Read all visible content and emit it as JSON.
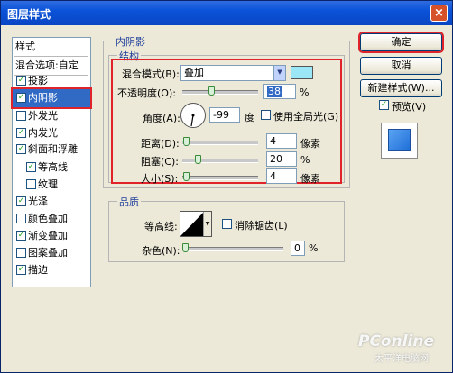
{
  "window": {
    "title": "图层样式",
    "close_glyph": "×"
  },
  "left_panel": {
    "header": "样式",
    "blend_options": "混合选项:自定",
    "items": [
      {
        "label": "投影",
        "checked": true
      },
      {
        "label": "内阴影",
        "checked": true
      },
      {
        "label": "外发光",
        "checked": false
      },
      {
        "label": "内发光",
        "checked": true
      },
      {
        "label": "斜面和浮雕",
        "checked": true
      },
      {
        "label": "等高线",
        "checked": true
      },
      {
        "label": "纹理",
        "checked": false
      },
      {
        "label": "光泽",
        "checked": true
      },
      {
        "label": "颜色叠加",
        "checked": false
      },
      {
        "label": "渐变叠加",
        "checked": true
      },
      {
        "label": "图案叠加",
        "checked": false
      },
      {
        "label": "描边",
        "checked": true
      }
    ]
  },
  "inner_shadow": {
    "section_title": "内阴影",
    "structure_title": "结构",
    "blend_mode_label": "混合模式(B):",
    "blend_mode_value": "叠加",
    "blend_color": "#9be7f6",
    "opacity_label": "不透明度(O):",
    "opacity_value": "38",
    "opacity_unit": "%",
    "opacity_level": 38,
    "angle_label": "角度(A):",
    "angle_value": "-99",
    "angle_unit": "度",
    "global_light_label": "使用全局光(G)",
    "global_light_checked": false,
    "distance_label": "距离(D):",
    "distance_value": "4",
    "distance_unit": "像素",
    "choke_label": "阻塞(C):",
    "choke_value": "20",
    "choke_unit": "%",
    "size_label": "大小(S):",
    "size_value": "4",
    "size_unit": "像素"
  },
  "quality": {
    "section_title": "品质",
    "contour_label": "等高线:",
    "antialias_label": "消除锯齿(L)",
    "antialias_checked": false,
    "noise_label": "杂色(N):",
    "noise_value": "0",
    "noise_unit": "%"
  },
  "buttons": {
    "ok": "确定",
    "cancel": "取消",
    "new_style": "新建样式(W)...",
    "preview_label": "预览(V)",
    "preview_checked": true
  },
  "watermark": {
    "brand": "PConline",
    "tagline": "太平洋电脑网"
  },
  "colors": {
    "highlight_red": "#e0232a",
    "selection_blue": "#316ac5",
    "titlebar_blue": "#0a52d8",
    "preview_swatch": "#2a7de0"
  }
}
